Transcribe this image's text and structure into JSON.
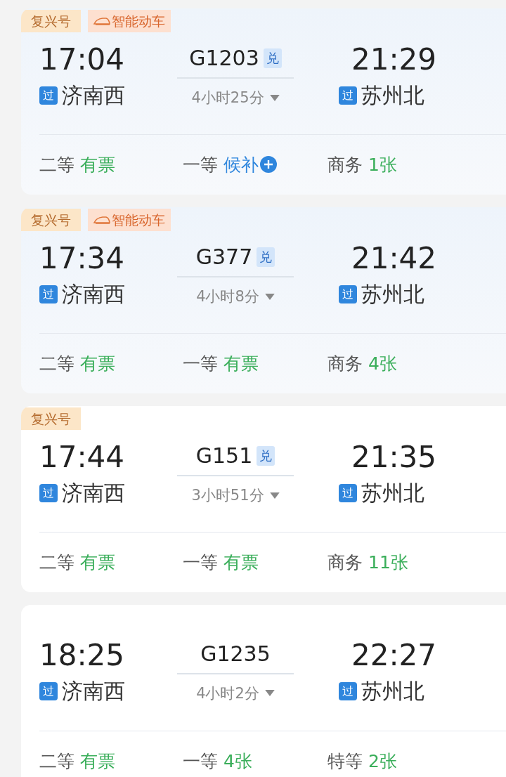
{
  "trains": [
    {
      "highlighted": true,
      "tags": [
        {
          "kind": "plain",
          "label": "复兴号"
        },
        {
          "kind": "smart",
          "label": "智能动车"
        }
      ],
      "depart_time": "17:04",
      "depart_badge": "过",
      "depart_station": "济南西",
      "number": "G1203",
      "number_badge": "兑",
      "duration": "4小时25分",
      "arrive_time": "21:29",
      "arrive_badge": "过",
      "arrive_station": "苏州北",
      "seats": [
        {
          "class": "二等",
          "kind": "available",
          "status": "有票"
        },
        {
          "class": "一等",
          "kind": "waitlist",
          "status": "候补"
        },
        {
          "class": "商务",
          "kind": "available",
          "status": "1张"
        }
      ]
    },
    {
      "highlighted": true,
      "tags": [
        {
          "kind": "plain",
          "label": "复兴号"
        },
        {
          "kind": "smart",
          "label": "智能动车"
        }
      ],
      "depart_time": "17:34",
      "depart_badge": "过",
      "depart_station": "济南西",
      "number": "G377",
      "number_badge": "兑",
      "duration": "4小时8分",
      "arrive_time": "21:42",
      "arrive_badge": "过",
      "arrive_station": "苏州北",
      "seats": [
        {
          "class": "二等",
          "kind": "available",
          "status": "有票"
        },
        {
          "class": "一等",
          "kind": "available",
          "status": "有票"
        },
        {
          "class": "商务",
          "kind": "available",
          "status": "4张"
        }
      ]
    },
    {
      "highlighted": false,
      "tags": [
        {
          "kind": "plain",
          "label": "复兴号"
        }
      ],
      "depart_time": "17:44",
      "depart_badge": "过",
      "depart_station": "济南西",
      "number": "G151",
      "number_badge": "兑",
      "duration": "3小时51分",
      "arrive_time": "21:35",
      "arrive_badge": "过",
      "arrive_station": "苏州北",
      "seats": [
        {
          "class": "二等",
          "kind": "available",
          "status": "有票"
        },
        {
          "class": "一等",
          "kind": "available",
          "status": "有票"
        },
        {
          "class": "商务",
          "kind": "available",
          "status": "11张"
        }
      ]
    },
    {
      "highlighted": false,
      "depart_time": "18:25",
      "depart_badge": "过",
      "depart_station": "济南西",
      "number": "G1235",
      "duration": "4小时2分",
      "arrive_time": "22:27",
      "arrive_badge": "过",
      "arrive_station": "苏州北",
      "seats": [
        {
          "class": "二等",
          "kind": "available",
          "status": "有票"
        },
        {
          "class": "一等",
          "kind": "available",
          "status": "4张"
        },
        {
          "class": "特等",
          "kind": "available",
          "status": "2张"
        }
      ]
    }
  ]
}
